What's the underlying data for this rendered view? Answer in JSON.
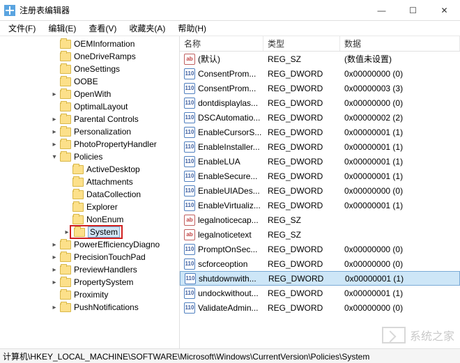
{
  "title": "注册表编辑器",
  "window": {
    "min": "—",
    "max": "☐",
    "close": "✕"
  },
  "menu": {
    "file": "文件(F)",
    "edit": "编辑(E)",
    "view": "查看(V)",
    "favorites": "收藏夹(A)",
    "help": "帮助(H)"
  },
  "tree": [
    {
      "indent": 72,
      "toggle": "",
      "label": "OEMInformation"
    },
    {
      "indent": 72,
      "toggle": "",
      "label": "OneDriveRamps"
    },
    {
      "indent": 72,
      "toggle": "",
      "label": "OneSettings"
    },
    {
      "indent": 72,
      "toggle": "",
      "label": "OOBE"
    },
    {
      "indent": 72,
      "toggle": ">",
      "label": "OpenWith"
    },
    {
      "indent": 72,
      "toggle": "",
      "label": "OptimalLayout"
    },
    {
      "indent": 72,
      "toggle": ">",
      "label": "Parental Controls"
    },
    {
      "indent": 72,
      "toggle": ">",
      "label": "Personalization"
    },
    {
      "indent": 72,
      "toggle": ">",
      "label": "PhotoPropertyHandler"
    },
    {
      "indent": 72,
      "toggle": "v",
      "label": "Policies"
    },
    {
      "indent": 90,
      "toggle": "",
      "label": "ActiveDesktop"
    },
    {
      "indent": 90,
      "toggle": "",
      "label": "Attachments"
    },
    {
      "indent": 90,
      "toggle": "",
      "label": "DataCollection"
    },
    {
      "indent": 90,
      "toggle": "",
      "label": "Explorer"
    },
    {
      "indent": 90,
      "toggle": "",
      "label": "NonEnum"
    },
    {
      "indent": 90,
      "toggle": ">",
      "label": "System",
      "selected": true,
      "boxed": true
    },
    {
      "indent": 72,
      "toggle": ">",
      "label": "PowerEfficiencyDiagno"
    },
    {
      "indent": 72,
      "toggle": ">",
      "label": "PrecisionTouchPad"
    },
    {
      "indent": 72,
      "toggle": ">",
      "label": "PreviewHandlers"
    },
    {
      "indent": 72,
      "toggle": ">",
      "label": "PropertySystem"
    },
    {
      "indent": 72,
      "toggle": "",
      "label": "Proximity"
    },
    {
      "indent": 72,
      "toggle": ">",
      "label": "PushNotifications"
    }
  ],
  "columns": {
    "name": "名称",
    "type": "类型",
    "data": "数据"
  },
  "values": [
    {
      "icon": "sz",
      "name": "(默认)",
      "type": "REG_SZ",
      "data": "(数值未设置)"
    },
    {
      "icon": "dw",
      "name": "ConsentProm...",
      "type": "REG_DWORD",
      "data": "0x00000000 (0)"
    },
    {
      "icon": "dw",
      "name": "ConsentProm...",
      "type": "REG_DWORD",
      "data": "0x00000003 (3)"
    },
    {
      "icon": "dw",
      "name": "dontdisplaylas...",
      "type": "REG_DWORD",
      "data": "0x00000000 (0)"
    },
    {
      "icon": "dw",
      "name": "DSCAutomatio...",
      "type": "REG_DWORD",
      "data": "0x00000002 (2)"
    },
    {
      "icon": "dw",
      "name": "EnableCursorS...",
      "type": "REG_DWORD",
      "data": "0x00000001 (1)"
    },
    {
      "icon": "dw",
      "name": "EnableInstaller...",
      "type": "REG_DWORD",
      "data": "0x00000001 (1)"
    },
    {
      "icon": "dw",
      "name": "EnableLUA",
      "type": "REG_DWORD",
      "data": "0x00000001 (1)"
    },
    {
      "icon": "dw",
      "name": "EnableSecure...",
      "type": "REG_DWORD",
      "data": "0x00000001 (1)"
    },
    {
      "icon": "dw",
      "name": "EnableUIADes...",
      "type": "REG_DWORD",
      "data": "0x00000000 (0)"
    },
    {
      "icon": "dw",
      "name": "EnableVirtualiz...",
      "type": "REG_DWORD",
      "data": "0x00000001 (1)"
    },
    {
      "icon": "sz",
      "name": "legalnoticecap...",
      "type": "REG_SZ",
      "data": ""
    },
    {
      "icon": "sz",
      "name": "legalnoticetext",
      "type": "REG_SZ",
      "data": ""
    },
    {
      "icon": "dw",
      "name": "PromptOnSec...",
      "type": "REG_DWORD",
      "data": "0x00000000 (0)"
    },
    {
      "icon": "dw",
      "name": "scforceoption",
      "type": "REG_DWORD",
      "data": "0x00000000 (0)"
    },
    {
      "icon": "dw",
      "name": "shutdownwith...",
      "type": "REG_DWORD",
      "data": "0x00000001 (1)",
      "selected": true
    },
    {
      "icon": "dw",
      "name": "undockwithout...",
      "type": "REG_DWORD",
      "data": "0x00000001 (1)"
    },
    {
      "icon": "dw",
      "name": "ValidateAdmin...",
      "type": "REG_DWORD",
      "data": "0x00000000 (0)"
    }
  ],
  "statusbar": "计算机\\HKEY_LOCAL_MACHINE\\SOFTWARE\\Microsoft\\Windows\\CurrentVersion\\Policies\\System",
  "watermark": "系统之家"
}
